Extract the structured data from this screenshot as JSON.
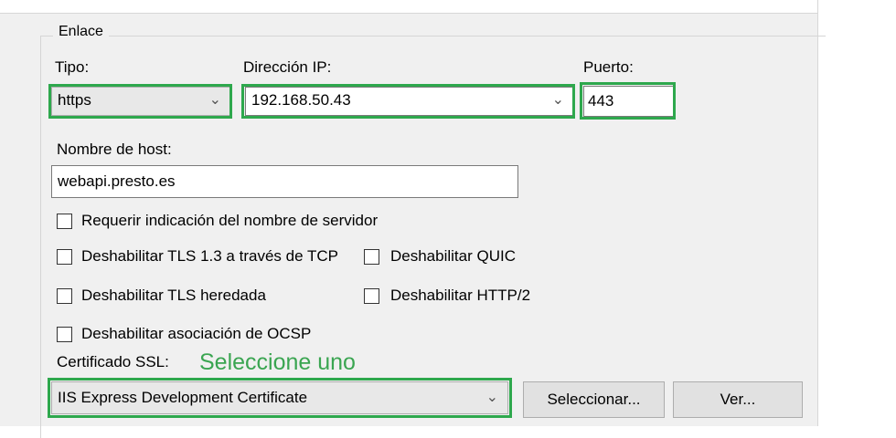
{
  "group": {
    "title": "Enlace"
  },
  "tipo": {
    "label": "Tipo:",
    "value": "https"
  },
  "ip": {
    "label": "Dirección IP:",
    "value": "192.168.50.43"
  },
  "puerto": {
    "label": "Puerto:",
    "value": "443"
  },
  "host": {
    "label": "Nombre de host:",
    "value": "webapi.presto.es"
  },
  "checkboxes": {
    "sni": "Requerir indicación del nombre de servidor",
    "tls13": "Deshabilitar TLS 1.3 a través de TCP",
    "quic": "Deshabilitar QUIC",
    "legacy_tls": "Deshabilitar TLS heredada",
    "http2": "Deshabilitar HTTP/2",
    "ocsp": "Deshabilitar asociación de OCSP"
  },
  "ssl": {
    "label": "Certificado SSL:",
    "annotation": "Seleccione uno",
    "value": "IIS Express Development Certificate",
    "select_button": "Seleccionar...",
    "view_button": "Ver..."
  },
  "colors": {
    "highlight": "#2ea84d",
    "annotation": "#3aa551"
  },
  "icons": {
    "dropdown": "chevron-down-icon"
  }
}
